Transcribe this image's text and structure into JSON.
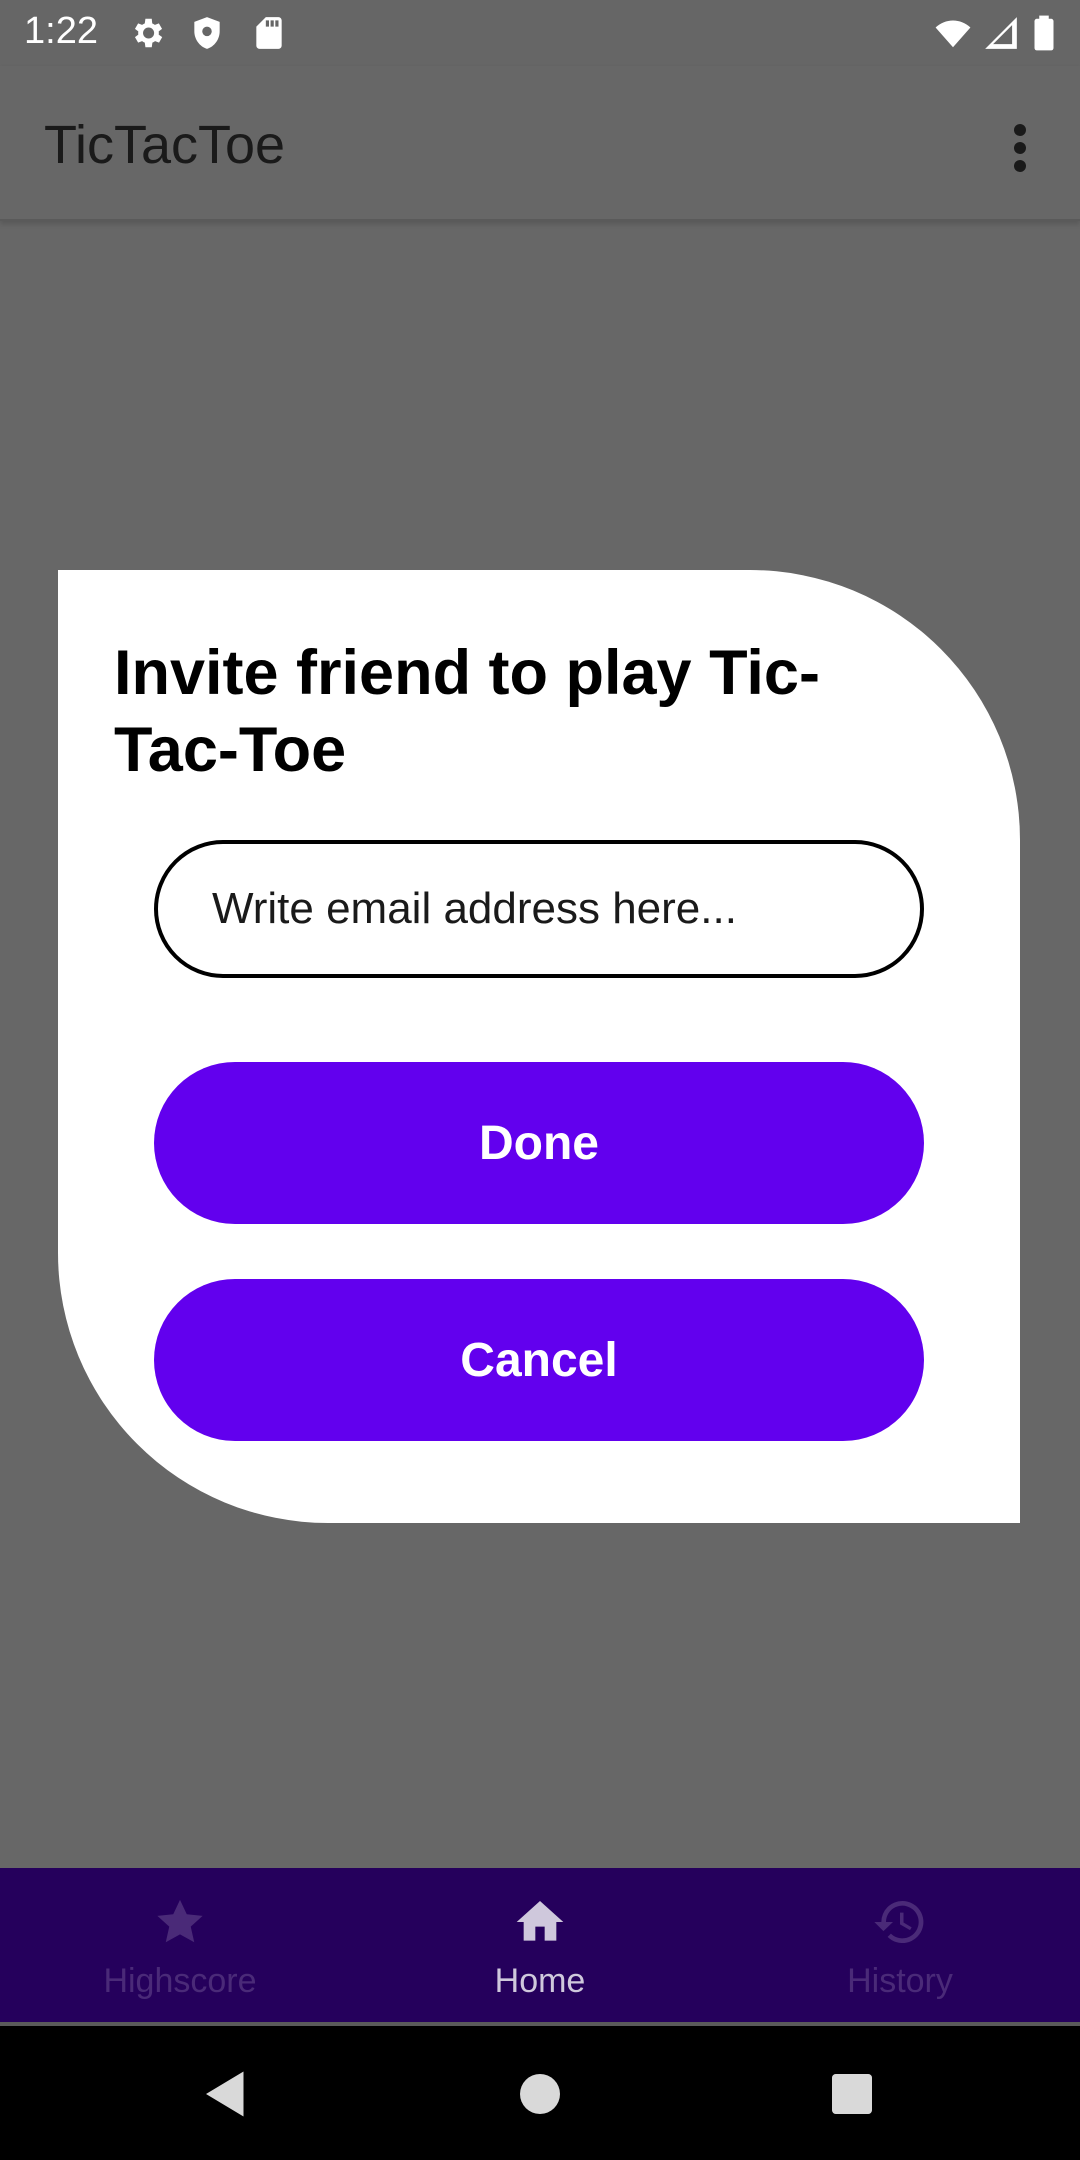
{
  "status_bar": {
    "time": "1:22",
    "left_icons": [
      "settings-icon",
      "shield-icon",
      "sd-card-icon"
    ],
    "right_icons": [
      "wifi-icon",
      "cell-signal-icon",
      "battery-icon"
    ]
  },
  "app_bar": {
    "title": "TicTacToe",
    "overflow_icon": "more-vert-icon"
  },
  "dialog": {
    "title": "Invite friend to play Tic-Tac-Toe",
    "email_placeholder": "Write email address here...",
    "email_value": "",
    "done_label": "Done",
    "cancel_label": "Cancel",
    "button_color": "#6200ee"
  },
  "bottom_nav": {
    "items": [
      {
        "label": "Highscore",
        "icon": "star-icon",
        "active": false
      },
      {
        "label": "Home",
        "icon": "home-icon",
        "active": true
      },
      {
        "label": "History",
        "icon": "history-icon",
        "active": false
      }
    ],
    "background": "#25005c"
  },
  "system_nav": {
    "icons": [
      "back-icon",
      "home-circle-icon",
      "recents-icon"
    ]
  },
  "colors": {
    "scrim": "#676767",
    "accent": "#6200ee"
  }
}
